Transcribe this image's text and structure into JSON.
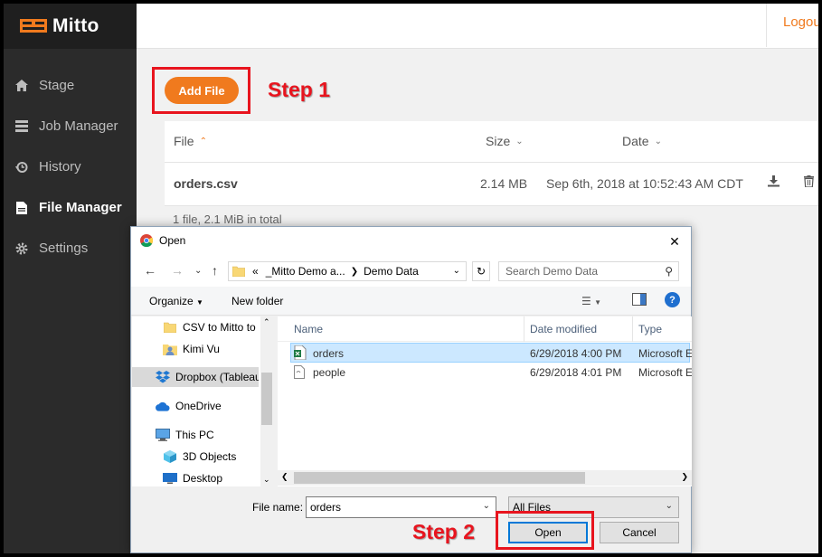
{
  "app": {
    "name": "Mitto",
    "logout": "Logout",
    "brand_color": "#f07a1e"
  },
  "sidebar": {
    "items": [
      {
        "label": "Stage",
        "icon": "home-icon"
      },
      {
        "label": "Job Manager",
        "icon": "server-icon"
      },
      {
        "label": "History",
        "icon": "history-icon"
      },
      {
        "label": "File Manager",
        "icon": "file-icon",
        "active": true
      },
      {
        "label": "Settings",
        "icon": "gear-icon"
      }
    ]
  },
  "main": {
    "add_file": "Add File",
    "table": {
      "columns": [
        "File",
        "Size",
        "Date"
      ],
      "rows": [
        {
          "file": "orders.csv",
          "size": "2.14 MB",
          "date": "Sep 6th, 2018 at 10:52:43 AM CDT"
        }
      ]
    },
    "summary": "1 file, 2.1 MiB in total"
  },
  "annotations": {
    "step1": "Step 1",
    "step2": "Step 2",
    "color": "#e8141e"
  },
  "dialog": {
    "title": "Open",
    "breadcrumb": [
      "«",
      "_Mitto Demo a...",
      "Demo Data"
    ],
    "search_placeholder": "Search Demo Data",
    "organize": "Organize",
    "new_folder": "New folder",
    "tree": [
      {
        "label": "CSV to Mitto to T",
        "icon": "folder-icon"
      },
      {
        "label": "Kimi Vu",
        "icon": "user-folder-icon"
      },
      {
        "label": "Dropbox (Tableau",
        "icon": "dropbox-icon",
        "selected": true
      },
      {
        "label": "OneDrive",
        "icon": "cloud-icon"
      },
      {
        "label": "This PC",
        "icon": "computer-icon"
      },
      {
        "label": "3D Objects",
        "icon": "cube-icon"
      },
      {
        "label": "Desktop",
        "icon": "desktop-icon"
      }
    ],
    "columns": [
      "Name",
      "Date modified",
      "Type"
    ],
    "files": [
      {
        "name": "orders",
        "date": "6/29/2018 4:00 PM",
        "type": "Microsoft Ex",
        "selected": true
      },
      {
        "name": "people",
        "date": "6/29/2018 4:01 PM",
        "type": "Microsoft Ex"
      }
    ],
    "file_name_label": "File name:",
    "file_name_value": "orders",
    "file_type": "All Files",
    "open": "Open",
    "cancel": "Cancel"
  }
}
